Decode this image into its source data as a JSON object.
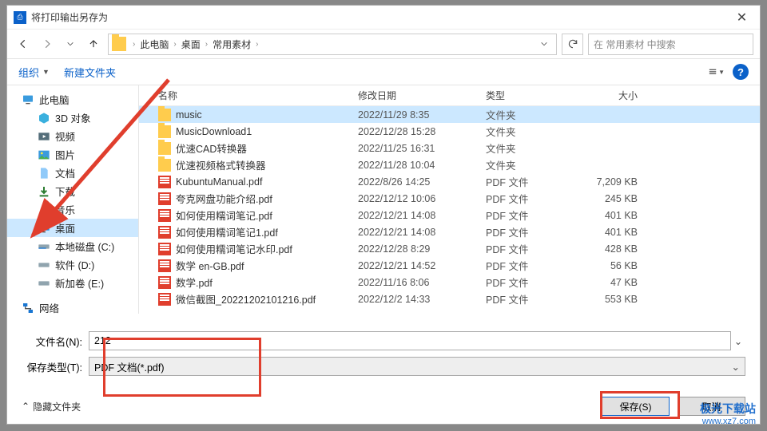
{
  "title": "将打印输出另存为",
  "breadcrumb": {
    "root": "此电脑",
    "items": [
      "桌面",
      "常用素材"
    ]
  },
  "search_placeholder": "在 常用素材 中搜索",
  "toolbar": {
    "organize": "组织",
    "new_folder": "新建文件夹"
  },
  "columns": {
    "name": "名称",
    "date": "修改日期",
    "type": "类型",
    "size": "大小"
  },
  "tree": {
    "this_pc": "此电脑",
    "objects_3d": "3D 对象",
    "videos": "视频",
    "pictures": "图片",
    "documents": "文档",
    "downloads": "下载",
    "music": "音乐",
    "desktop": "桌面",
    "disk_c": "本地磁盘 (C:)",
    "disk_d": "软件 (D:)",
    "disk_e": "新加卷 (E:)",
    "network": "网络"
  },
  "files": [
    {
      "icon": "folder",
      "name": "music",
      "date": "2022/11/29 8:35",
      "type": "文件夹",
      "size": ""
    },
    {
      "icon": "folder",
      "name": "MusicDownload1",
      "date": "2022/12/28 15:28",
      "type": "文件夹",
      "size": ""
    },
    {
      "icon": "folder",
      "name": "优速CAD转换器",
      "date": "2022/11/25 16:31",
      "type": "文件夹",
      "size": ""
    },
    {
      "icon": "folder",
      "name": "优速视频格式转换器",
      "date": "2022/11/28 10:04",
      "type": "文件夹",
      "size": ""
    },
    {
      "icon": "pdf",
      "name": "KubuntuManual.pdf",
      "date": "2022/8/26 14:25",
      "type": "PDF 文件",
      "size": "7,209 KB"
    },
    {
      "icon": "pdf",
      "name": "夸克网盘功能介绍.pdf",
      "date": "2022/12/12 10:06",
      "type": "PDF 文件",
      "size": "245 KB"
    },
    {
      "icon": "pdf",
      "name": "如何使用糯词笔记.pdf",
      "date": "2022/12/21 14:08",
      "type": "PDF 文件",
      "size": "401 KB"
    },
    {
      "icon": "pdf",
      "name": "如何使用糯词笔记1.pdf",
      "date": "2022/12/21 14:08",
      "type": "PDF 文件",
      "size": "401 KB"
    },
    {
      "icon": "pdf",
      "name": "如何使用糯词笔记水印.pdf",
      "date": "2022/12/28 8:29",
      "type": "PDF 文件",
      "size": "428 KB"
    },
    {
      "icon": "pdf",
      "name": "数学 en-GB.pdf",
      "date": "2022/12/21 14:52",
      "type": "PDF 文件",
      "size": "56 KB"
    },
    {
      "icon": "pdf",
      "name": "数学.pdf",
      "date": "2022/11/16 8:06",
      "type": "PDF 文件",
      "size": "47 KB"
    },
    {
      "icon": "pdf",
      "name": "微信截图_20221202101216.pdf",
      "date": "2022/12/2 14:33",
      "type": "PDF 文件",
      "size": "553 KB"
    }
  ],
  "form": {
    "filename_label": "文件名(N):",
    "filename_value": "212",
    "filetype_label": "保存类型(T):",
    "filetype_value": "PDF 文档(*.pdf)"
  },
  "footer": {
    "hide_folders": "隐藏文件夹",
    "save": "保存(S)",
    "cancel": "取消"
  },
  "watermark": {
    "brand": "极光下载站",
    "url": "www.xz7.com"
  }
}
